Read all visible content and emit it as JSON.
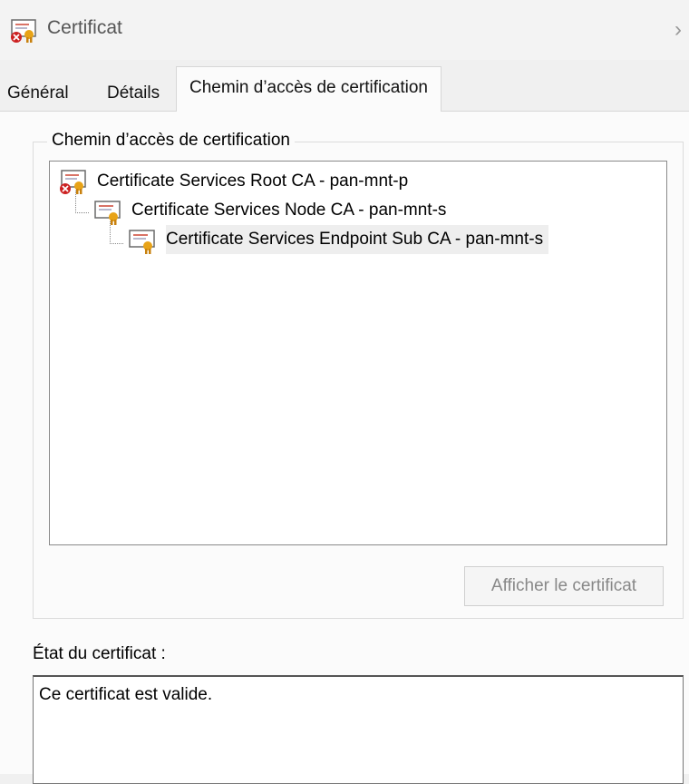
{
  "window": {
    "title": "Certificat",
    "close_glyph": "›"
  },
  "tabs": [
    {
      "label": "Général",
      "active": false
    },
    {
      "label": "Détails",
      "active": false
    },
    {
      "label": "Chemin d’accès de certification",
      "active": true
    }
  ],
  "certification_path": {
    "group_label": "Chemin d’accès de certification",
    "items": [
      {
        "label": "Certificate Services Root CA - pan-mnt-p",
        "level": 0,
        "icon": "certificate-error-icon",
        "selected": false
      },
      {
        "label": "Certificate Services Node CA - pan-mnt-s",
        "level": 1,
        "icon": "certificate-icon",
        "selected": false
      },
      {
        "label": "Certificate Services Endpoint Sub CA - pan-mnt-s",
        "level": 2,
        "icon": "certificate-icon",
        "selected": true
      }
    ],
    "view_button_label": "Afficher le certificat",
    "view_button_enabled": false
  },
  "status": {
    "label": "État du certificat :",
    "text": "Ce certificat est valide."
  },
  "colors": {
    "background": "#f0f0f0",
    "panel": "#fbfbfb",
    "disabled_text": "#888888",
    "cert_ribbon": "#e8a317",
    "error_badge": "#cc2222"
  }
}
